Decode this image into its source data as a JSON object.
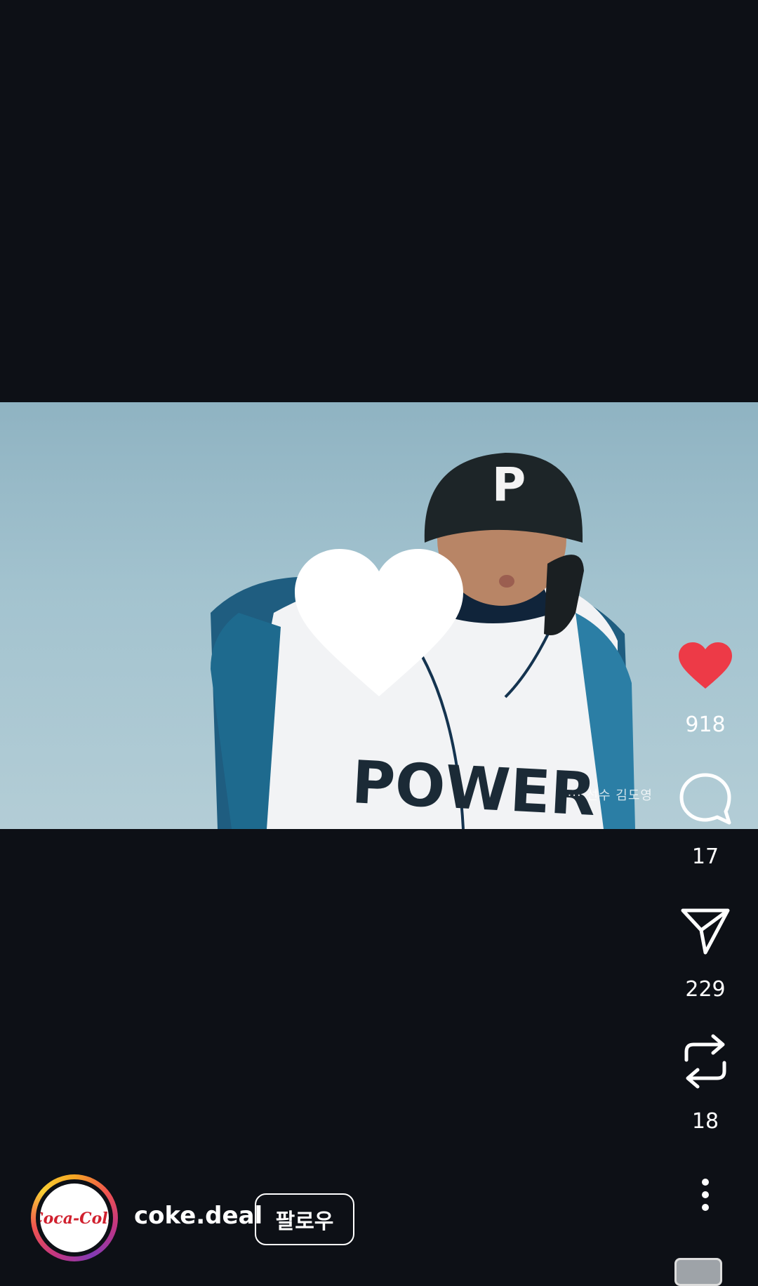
{
  "video": {
    "helmet_letter": "P",
    "jersey_text": "POWER",
    "caption": "··· 선수 김도영"
  },
  "actions": {
    "like_count": "918",
    "comment_count": "17",
    "share_count": "229",
    "repost_count": "18",
    "like_color": "#ed3a47"
  },
  "author": {
    "username": "coke.deal",
    "logo_text": "Coca-Cola",
    "follow_label": "팔로우"
  }
}
